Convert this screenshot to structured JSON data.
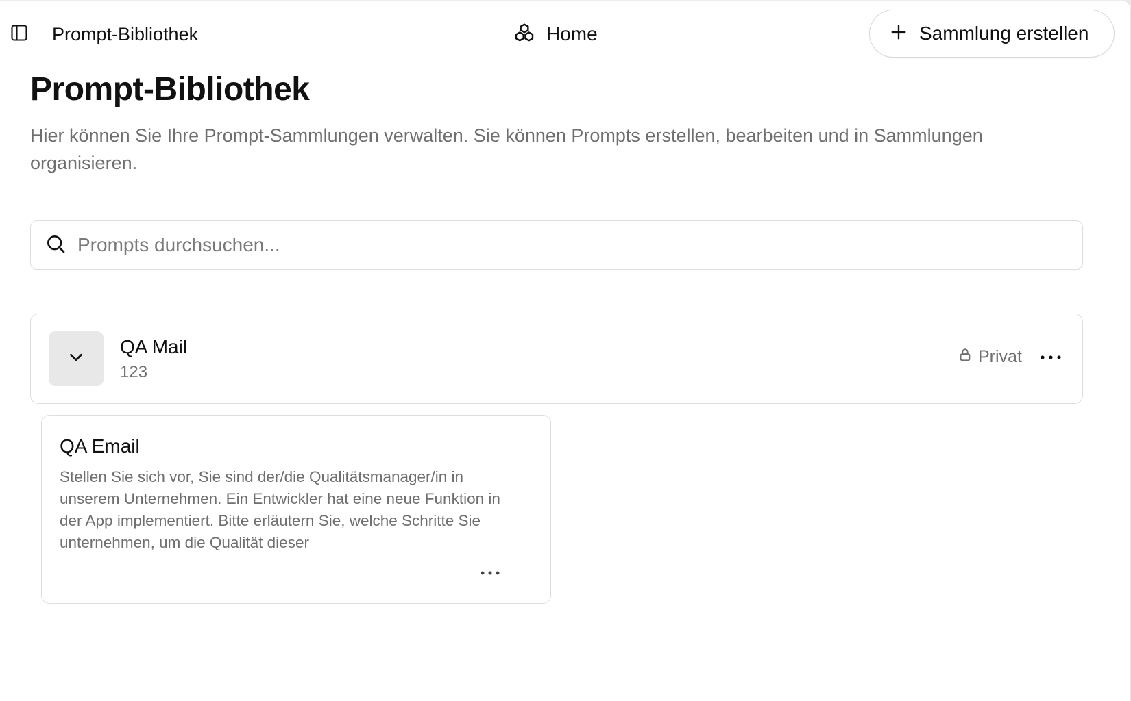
{
  "header": {
    "app_title": "Prompt-Bibliothek",
    "home_label": "Home",
    "create_collection_label": "Sammlung erstellen"
  },
  "page": {
    "title": "Prompt-Bibliothek",
    "description": "Hier können Sie Ihre Prompt-Sammlungen verwalten. Sie können Prompts erstellen, bearbeiten und in Sammlungen organisieren."
  },
  "search": {
    "placeholder": "Prompts durchsuchen..."
  },
  "collection": {
    "name": "QA Mail",
    "count": "123",
    "visibility": "Privat",
    "expanded": true,
    "prompts": [
      {
        "title": "QA Email",
        "text": "Stellen Sie sich vor, Sie sind der/die Qualitätsmanager/in in unserem Unternehmen. Ein Entwickler hat eine neue Funktion in der App implementiert. Bitte erläutern Sie, welche Schritte Sie unternehmen, um die Qualität dieser"
      }
    ]
  },
  "icons": {
    "sidebar_toggle": "sidebar-toggle-icon",
    "home": "boxes-icon",
    "create": "plus-icon",
    "search": "search-icon",
    "collapse": "chevron-down-icon",
    "visibility": "lock-icon",
    "more": "more-horizontal-icon"
  },
  "colors": {
    "background": "#ffffff",
    "border": "#dedede",
    "muted_text": "#6f6f6f",
    "toggle_background": "#e8e8e8"
  }
}
